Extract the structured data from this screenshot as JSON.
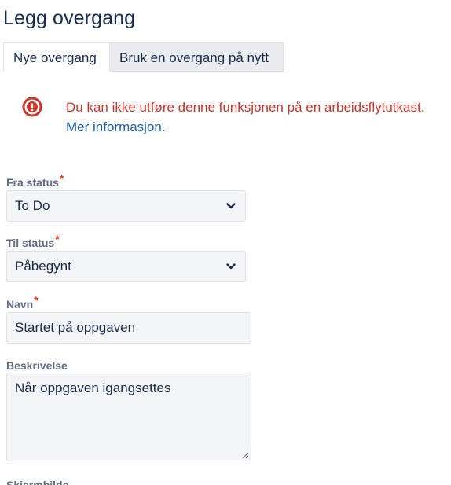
{
  "dialog": {
    "title": "Legg overgang"
  },
  "tabs": [
    {
      "label": "Nye overgang",
      "active": true
    },
    {
      "label": "Bruk en overgang på nytt",
      "active": false
    }
  ],
  "error": {
    "icon": "error-circle-icon",
    "color": "#c9372c",
    "message": "Du kan ikke utføre denne funksjonen på en arbeidsflytutkast.",
    "link": "Mer informasjon."
  },
  "form": {
    "from_status": {
      "label": "Fra status",
      "required": "*",
      "value": "To Do"
    },
    "to_status": {
      "label": "Til status",
      "required": "*",
      "value": "Påbegynt"
    },
    "name": {
      "label": "Navn",
      "required": "*",
      "value": "Startet på oppgaven"
    },
    "description": {
      "label": "Beskrivelse",
      "value": "Når oppgaven igangsettes"
    },
    "screen": {
      "label": "Skjermbilde"
    }
  }
}
